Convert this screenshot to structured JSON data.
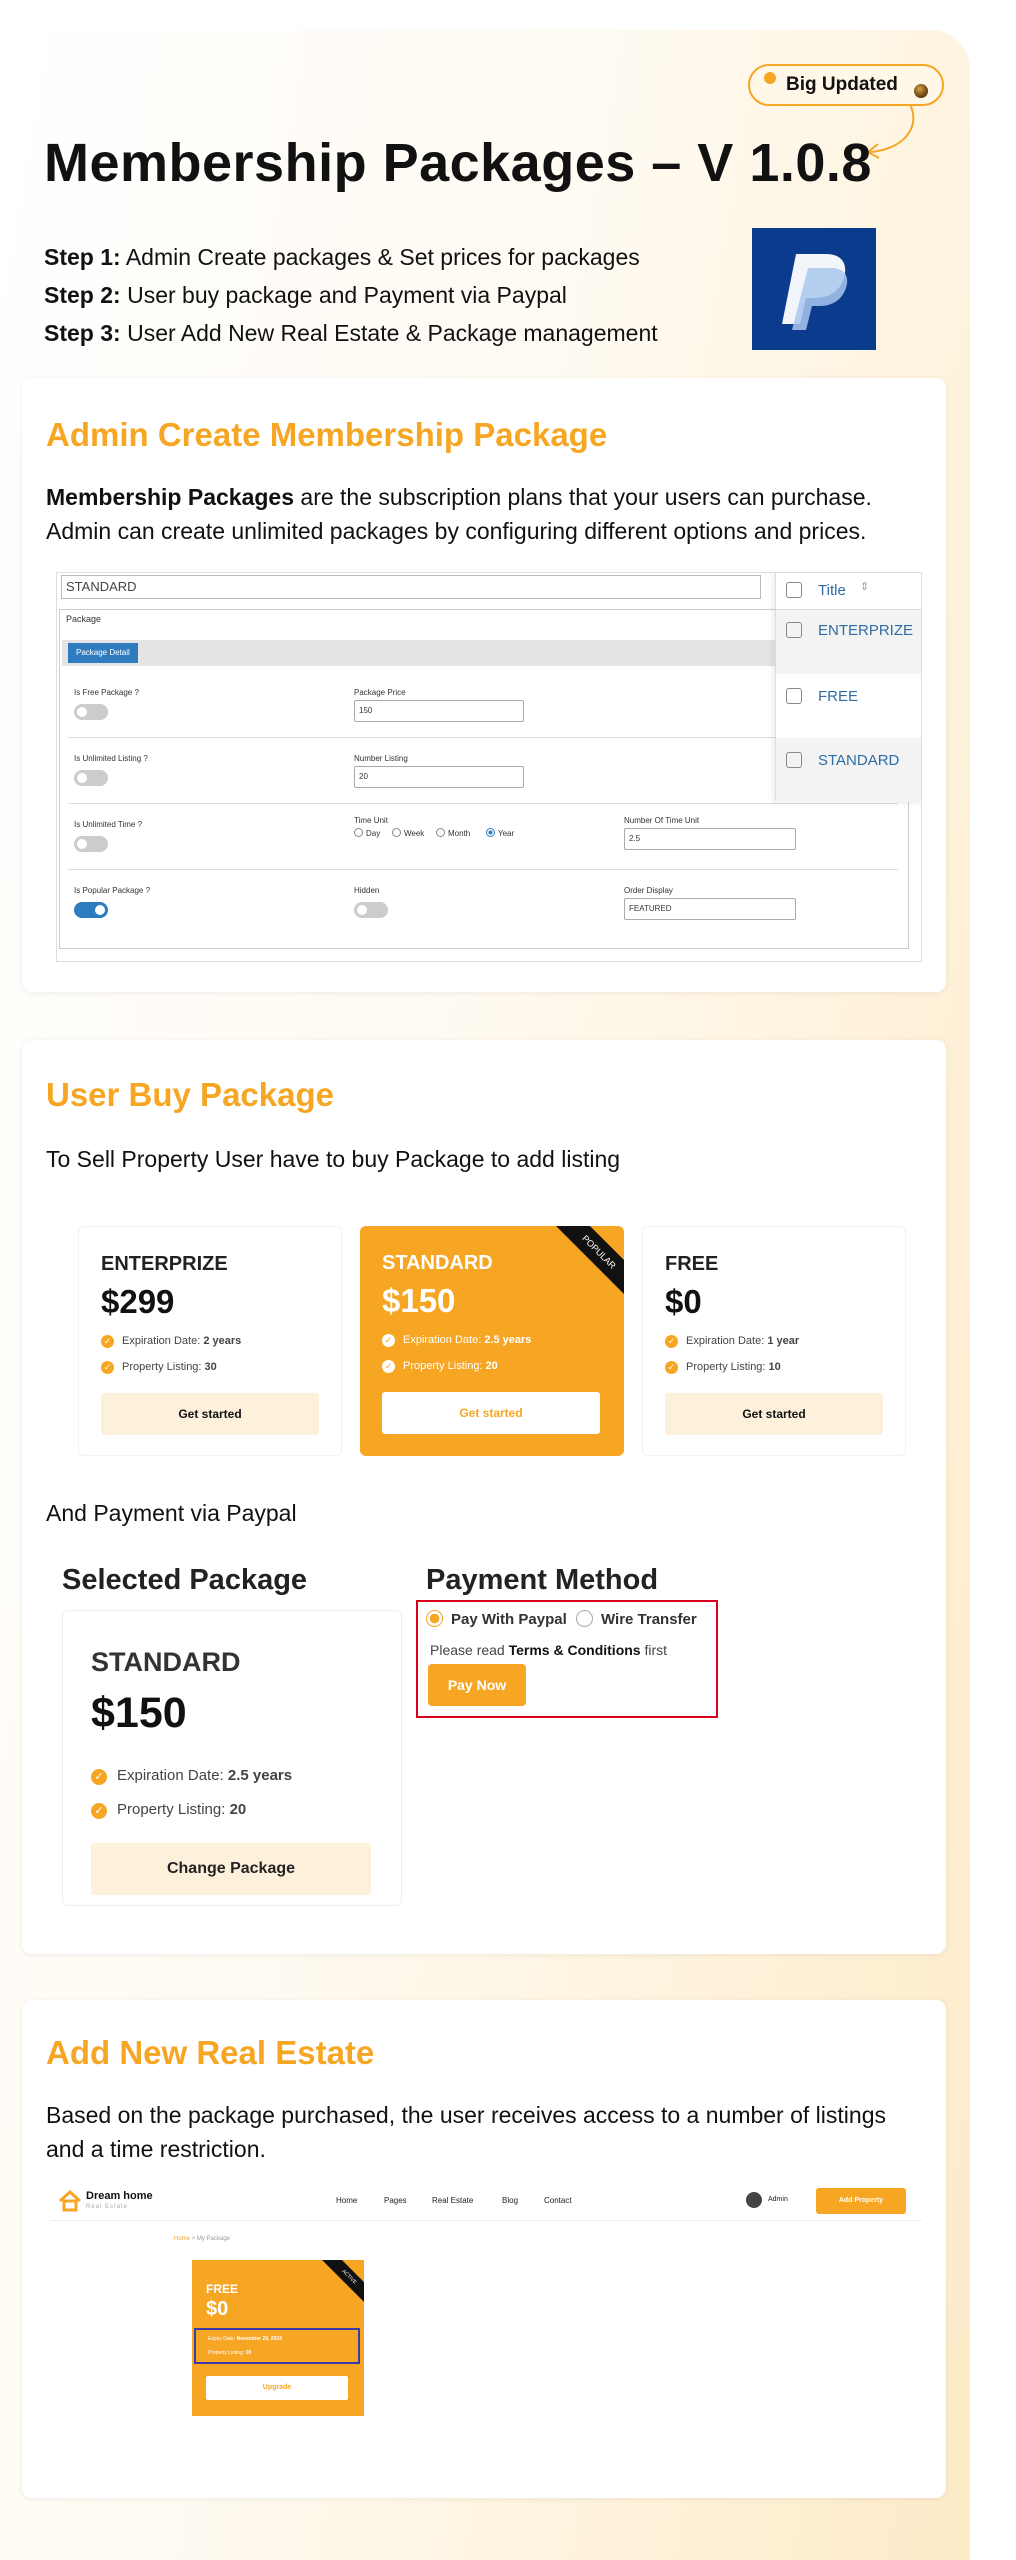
{
  "header": {
    "badge": "Big Updated",
    "title": "Membership Packages – V 1.0.8",
    "steps": [
      {
        "label": "Step 1:",
        "text": "Admin Create packages  & Set prices for packages"
      },
      {
        "label": "Step 2:",
        "text": "User buy  package and Payment via Paypal"
      },
      {
        "label": "Step 3:",
        "text": "User Add New Real Estate & Package management"
      }
    ]
  },
  "admin_section": {
    "title": "Admin Create Membership Package",
    "desc_bold": "Membership Packages",
    "desc_rest": " are the subscription plans that your users can purchase. Admin can create unlimited packages by configuring different options and prices.",
    "mock": {
      "search_value": "STANDARD",
      "panel_title": "Package",
      "tab_label": "Package Detail",
      "is_free_label": "Is Free Package ?",
      "price_label": "Package Price",
      "price_value": "150",
      "unlimited_listing_label": "Is Unlimited Listing ?",
      "number_listing_label": "Number Listing",
      "number_listing_value": "20",
      "unlimited_time_label": "Is Unlimited Time ?",
      "time_unit_label": "Time Unit",
      "time_units": [
        "Day",
        "Week",
        "Month",
        "Year"
      ],
      "time_unit_selected": "Year",
      "number_time_unit_label": "Number Of Time Unit",
      "number_time_unit_value": "2.5",
      "popular_label": "Is Popular Package ?",
      "hidden_label": "Hidden",
      "order_display_label": "Order Display",
      "order_display_value": "FEATURED",
      "toggles": {
        "is_free": false,
        "unlimited_listing": false,
        "unlimited_time": false,
        "popular": true,
        "hidden": false
      }
    },
    "title_list": {
      "header": "Title",
      "items": [
        "ENTERPRIZE",
        "FREE",
        "STANDARD"
      ]
    }
  },
  "user_buy_section": {
    "title": "User Buy Package",
    "desc": "To Sell Property User have to buy Package to add listing",
    "packages": [
      {
        "name": "ENTERPRIZE",
        "price": "$299",
        "exp_label": "Expiration Date: ",
        "exp": "2 years",
        "listing_label": "Property Listing: ",
        "listing": "30",
        "button": "Get started",
        "ribbon": ""
      },
      {
        "name": "STANDARD",
        "price": "$150",
        "exp_label": "Expiration Date: ",
        "exp": "2.5 years",
        "listing_label": "Property Listing: ",
        "listing": "20",
        "button": "Get started",
        "ribbon": "POPULAR"
      },
      {
        "name": "FREE",
        "price": "$0",
        "exp_label": "Expiration Date: ",
        "exp": "1 year",
        "listing_label": "Property Listing: ",
        "listing": "10",
        "button": "Get started",
        "ribbon": ""
      }
    ],
    "payment_note": "And Payment via Paypal",
    "checkout": {
      "selected_heading": "Selected Package",
      "payment_heading": "Payment Method",
      "selected": {
        "name": "STANDARD",
        "price": "$150",
        "exp_label": "Expiration Date: ",
        "exp": "2.5 years",
        "listing_label": "Property Listing: ",
        "listing": "20",
        "button": "Change Package"
      },
      "methods": [
        "Pay With Paypal",
        "Wire Transfer"
      ],
      "method_selected": "Pay With Paypal",
      "read_prefix": "Please read ",
      "read_link": "Terms & Conditions",
      "read_suffix": " first",
      "pay_button": "Pay Now"
    }
  },
  "add_section": {
    "title": "Add New Real Estate",
    "desc": "Based on the package purchased, the user receives access to a number of listings and a time restriction.",
    "site": {
      "logo_title": "Dream home",
      "logo_sub": "Real Estate",
      "nav": [
        "Home",
        "Pages",
        "Real Estate",
        "Blog",
        "Contact"
      ],
      "user": "Admin",
      "add_button": "Add Property",
      "breadcrumb_home": "Home",
      "breadcrumb_current": "My Package",
      "card": {
        "ribbon": "ACTIVE",
        "name": "FREE",
        "price": "$0",
        "expiry_label": "Expiry Date: ",
        "expiry": "November 29, 2024",
        "listing_label": "Property Listing: ",
        "listing": "10",
        "button": "Upgrade"
      }
    }
  },
  "colors": {
    "accent": "#f6a623",
    "paypal_bg": "#0b3b8c",
    "highlight_border": "#d9001b",
    "link_blue": "#2e6da4"
  }
}
